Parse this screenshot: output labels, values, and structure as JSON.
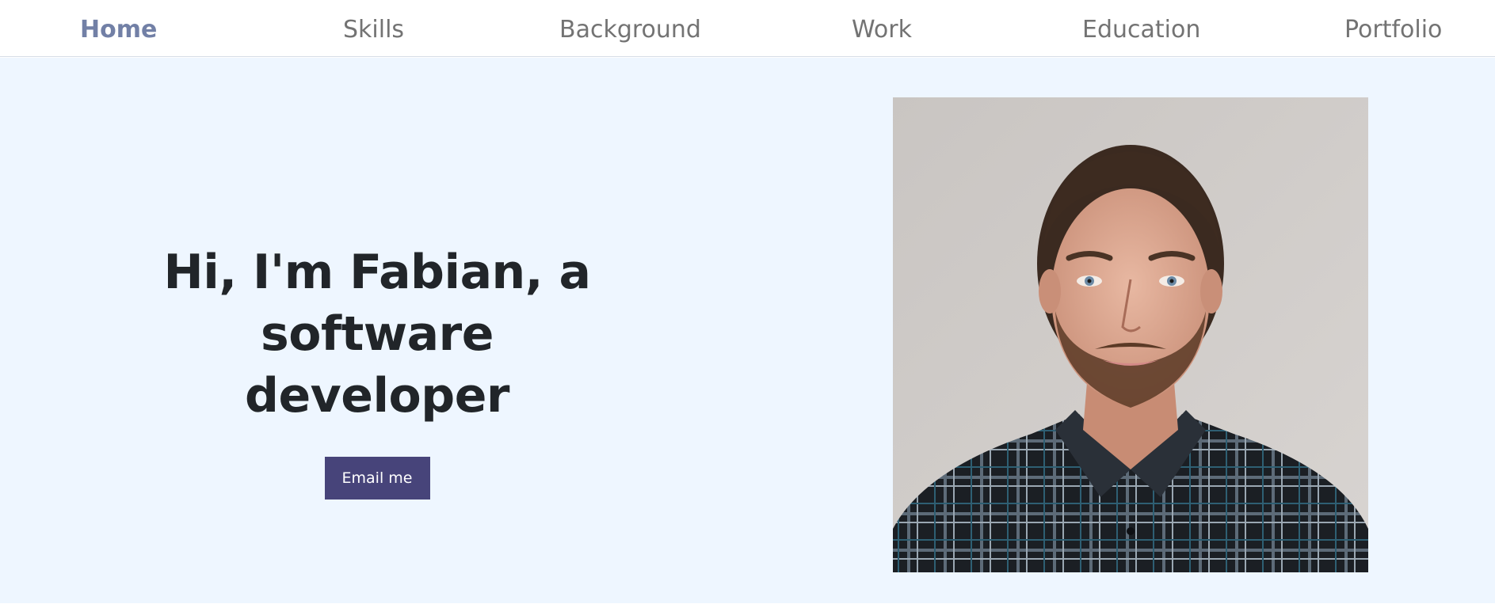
{
  "nav": {
    "items": [
      {
        "label": "Home",
        "active": true
      },
      {
        "label": "Skills",
        "active": false
      },
      {
        "label": "Background",
        "active": false
      },
      {
        "label": "Work",
        "active": false
      },
      {
        "label": "Education",
        "active": false
      },
      {
        "label": "Portfolio",
        "active": false
      }
    ]
  },
  "hero": {
    "headline_line1": "Hi, I'm Fabian, a software",
    "headline_line2": "developer",
    "email_button_label": "Email me"
  },
  "colors": {
    "nav_active": "#7280a6",
    "nav_text": "#737373",
    "hero_background": "#eef6ff",
    "headline": "#212529",
    "button_background": "#47447a",
    "button_text": "#ffffff"
  }
}
